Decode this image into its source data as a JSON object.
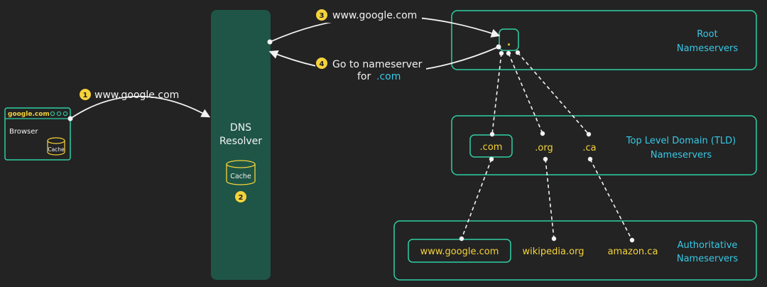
{
  "browser": {
    "url": "google.com",
    "label": "Browser",
    "cache_label": "Cache"
  },
  "resolver": {
    "title_line1": "DNS",
    "title_line2": "Resolver",
    "cache_label": "Cache",
    "step": "2"
  },
  "steps": [
    {
      "number": "1",
      "text": "www.google.com"
    },
    {
      "number": "3",
      "text": "www.google.com"
    },
    {
      "number": "4",
      "text_line1": "Go to nameserver",
      "text_line2_prefix": "for",
      "text_line2_highlight": ".com"
    }
  ],
  "root": {
    "dot": ".",
    "title_line1": "Root",
    "title_line2": "Nameservers"
  },
  "tld": {
    "domains": [
      ".com",
      ".org",
      ".ca"
    ],
    "title_line1": "Top Level Domain (TLD)",
    "title_line2": "Nameservers"
  },
  "authoritative": {
    "domains": [
      "www.google.com",
      "wikipedia.org",
      "amazon.ca"
    ],
    "title_line1": "Authoritative",
    "title_line2": "Nameservers"
  },
  "colors": {
    "background": "#232323",
    "panel_border": "#2fd0a4",
    "resolver_fill": "#1e5546",
    "accent_yellow": "#f5d33a",
    "accent_cyan": "#37c9e6",
    "text": "#f2f2f2"
  }
}
